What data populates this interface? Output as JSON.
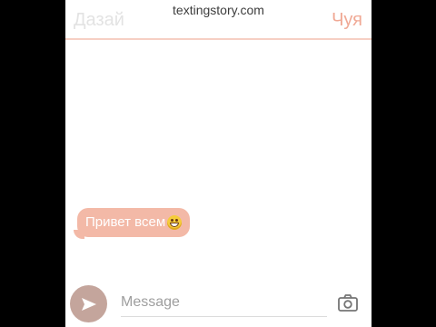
{
  "watermark": "textingstory.com",
  "header": {
    "left_contact": "Дазай",
    "right_contact": "Чуя"
  },
  "messages": [
    {
      "text": "Привет всем",
      "emoji": "grimacing-face",
      "side": "left"
    }
  ],
  "composer": {
    "placeholder": "Message",
    "send_icon": "send-icon",
    "camera_icon": "camera-icon"
  },
  "colors": {
    "accent": "#f0a995",
    "bubble": "#f3b9a7",
    "send_button": "#c4a59c"
  }
}
